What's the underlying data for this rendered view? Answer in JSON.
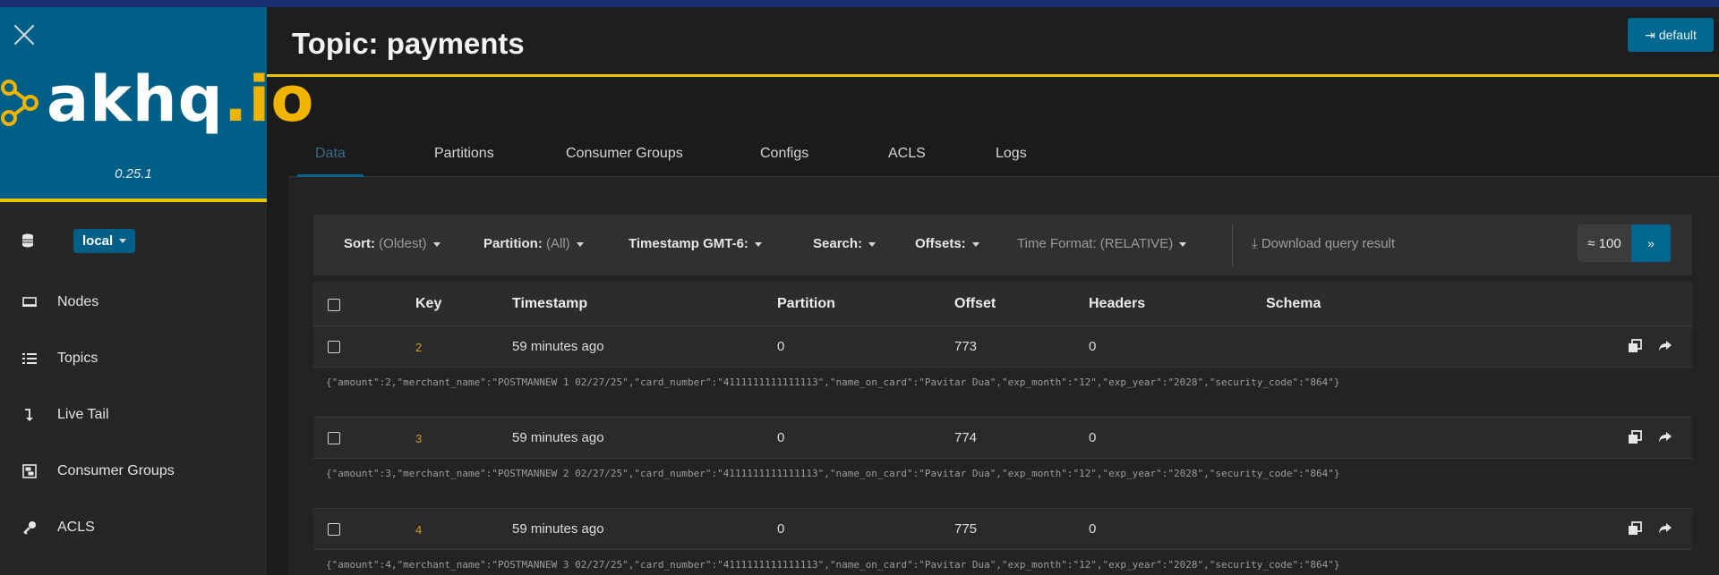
{
  "app": {
    "logo_main": "akhq",
    "logo_io": ".io",
    "version": "0.25.1",
    "cluster": "local",
    "login_label": "default"
  },
  "sidebar": {
    "items": [
      {
        "label": "Nodes",
        "icon": "server-icon"
      },
      {
        "label": "Topics",
        "icon": "list-icon"
      },
      {
        "label": "Live Tail",
        "icon": "level-down-icon"
      },
      {
        "label": "Consumer Groups",
        "icon": "object-group-icon"
      },
      {
        "label": "ACLS",
        "icon": "key-icon"
      }
    ]
  },
  "header": {
    "title": "Topic: payments"
  },
  "tabs": [
    "Data",
    "Partitions",
    "Consumer Groups",
    "Configs",
    "ACLS",
    "Logs"
  ],
  "toolbar": {
    "sort_label": "Sort:",
    "sort_value": "(Oldest)",
    "partition_label": "Partition:",
    "partition_value": "(All)",
    "timestamp_label": "Timestamp GMT-6:",
    "search_label": "Search:",
    "offsets_label": "Offsets:",
    "time_format": "Time Format: (RELATIVE)",
    "download": "Download query result",
    "page_size": "≈ 100",
    "go": "»"
  },
  "table": {
    "columns": [
      "Key",
      "Timestamp",
      "Partition",
      "Offset",
      "Headers",
      "Schema"
    ],
    "rows": [
      {
        "key": "2",
        "timestamp": "59 minutes ago",
        "partition": "0",
        "offset": "773",
        "headers": "0",
        "value": "{\"amount\":2,\"merchant_name\":\"POSTMANNEW 1 02/27/25\",\"card_number\":\"4111111111111113\",\"name_on_card\":\"Pavitar Dua\",\"exp_month\":\"12\",\"exp_year\":\"2028\",\"security_code\":\"864\"}"
      },
      {
        "key": "3",
        "timestamp": "59 minutes ago",
        "partition": "0",
        "offset": "774",
        "headers": "0",
        "value": "{\"amount\":3,\"merchant_name\":\"POSTMANNEW 2 02/27/25\",\"card_number\":\"4111111111111113\",\"name_on_card\":\"Pavitar Dua\",\"exp_month\":\"12\",\"exp_year\":\"2028\",\"security_code\":\"864\"}"
      },
      {
        "key": "4",
        "timestamp": "59 minutes ago",
        "partition": "0",
        "offset": "775",
        "headers": "0",
        "value": "{\"amount\":4,\"merchant_name\":\"POSTMANNEW 3 02/27/25\",\"card_number\":\"4111111111111113\",\"name_on_card\":\"Pavitar Dua\",\"exp_month\":\"12\",\"exp_year\":\"2028\",\"security_code\":\"864\"}"
      }
    ]
  },
  "colors": {
    "accent": "#00688f",
    "brand_yellow": "#e9c400",
    "key": "#d19a2a"
  }
}
